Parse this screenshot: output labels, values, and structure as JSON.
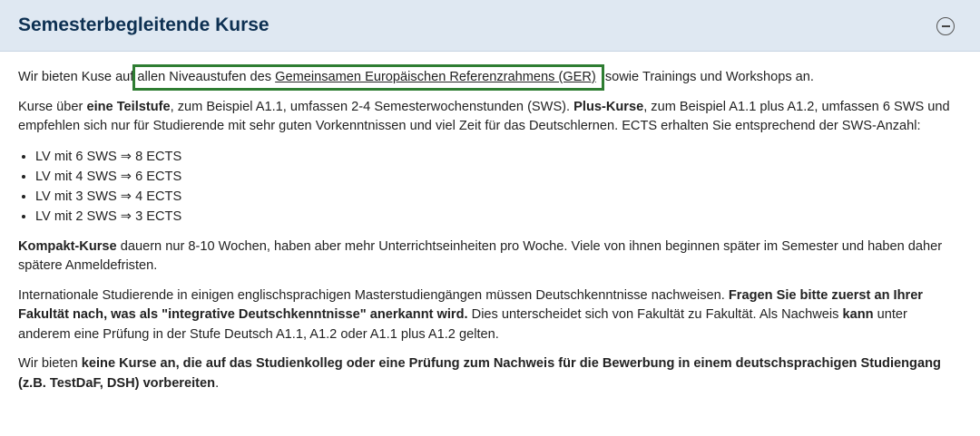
{
  "section": {
    "title": "Semesterbegleitende Kurse",
    "collapse_icon": "minus-circle-icon"
  },
  "p1": {
    "before": "Wir bieten Kuse auf ",
    "highlight_text": "allen Niveaustufen des ",
    "link_text": "Gemeinsamen Europäischen Referenzrahmens (GER)",
    "after": " sowie Trainings und Workshops an.",
    "highlight_color": "#2e7d32"
  },
  "p2": {
    "t1": "Kurse über ",
    "b1": "eine Teilstufe",
    "t2": ", zum Beispiel A1.1, umfassen 2-4 Semesterwochenstunden (SWS). ",
    "b2": "Plus-Kurse",
    "t3": ", zum Beispiel A1.1 plus A1.2, umfassen 6 SWS und empfehlen sich nur für Studierende mit sehr guten Vorkenntnissen und viel Zeit für das Deutschlernen. ECTS erhalten Sie entsprechend der SWS-Anzahl:"
  },
  "ects_list": [
    "LV mit 6 SWS ⇒ 8 ECTS",
    "LV mit 4 SWS ⇒ 6 ECTS",
    "LV mit 3 SWS ⇒ 4 ECTS",
    "LV mit 2 SWS ⇒ 3 ECTS"
  ],
  "p3": {
    "b1": "Kompakt-Kurse",
    "t1": " dauern nur 8-10 Wochen, haben aber mehr Unterrichtseinheiten pro Woche. Viele von ihnen beginnen später im Semester und haben daher spätere Anmeldefristen."
  },
  "p4": {
    "t1": "Internationale Studierende in einigen englischsprachigen Masterstudiengängen müssen Deutschkenntnisse nachweisen. ",
    "b1": "Fragen Sie bitte zuerst an Ihrer Fakultät nach, was als \"integrative Deutschkenntnisse\" anerkannt wird.",
    "t2": " Dies unterscheidet sich von Fakultät zu Fakultät. Als Nachweis ",
    "b2": "kann",
    "t3": " unter anderem eine Prüfung in der Stufe Deutsch A1.1, A1.2 oder A1.1 plus A1.2 gelten."
  },
  "p5": {
    "t1": "Wir bieten ",
    "b1": "keine Kurse an, die auf das Studienkolleg oder eine Prüfung zum Nachweis für die Bewerbung in einem deutschsprachigen Studiengang (z.B. TestDaF, DSH) vorbereiten",
    "t2": "."
  }
}
